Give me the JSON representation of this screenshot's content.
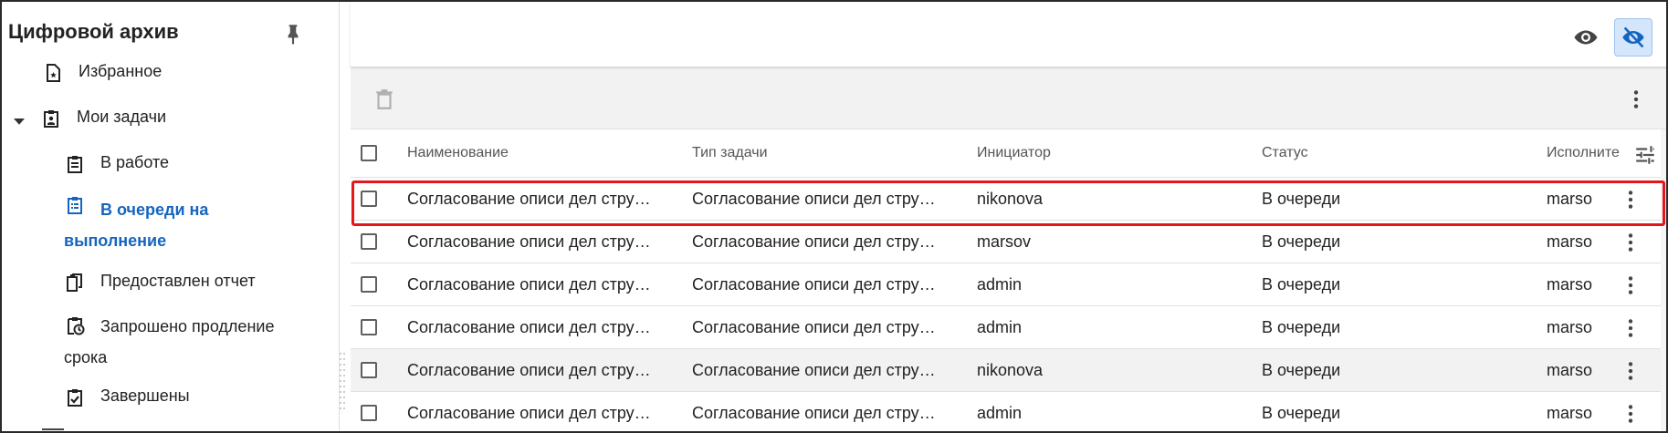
{
  "sidebar": {
    "title": "Цифровой архив",
    "items": [
      {
        "label": "Избранное",
        "icon": "favorite-doc-icon"
      },
      {
        "label": "Мои задачи",
        "icon": "clipboard-user-icon"
      },
      {
        "label": "В работе",
        "icon": "clipboard-list-icon"
      },
      {
        "label": "В очереди на выполнение",
        "icon": "clipboard-queue-icon"
      },
      {
        "label": "Предоставлен отчет",
        "icon": "report-copy-icon"
      },
      {
        "label": "Запрошено продление срока",
        "icon": "clipboard-clock-icon"
      },
      {
        "label": "Завершены",
        "icon": "clipboard-check-icon"
      }
    ],
    "active_color": "#1565c0"
  },
  "table": {
    "columns": [
      "Наименование",
      "Тип задачи",
      "Инициатор",
      "Статус",
      "Исполните"
    ],
    "rows": [
      {
        "name": "Согласование описи дел стру…",
        "type": "Согласование описи дел стру…",
        "initiator": "nikonova",
        "status": "В очереди",
        "executor": "marsov"
      },
      {
        "name": "Согласование описи дел стру…",
        "type": "Согласование описи дел стру…",
        "initiator": "marsov",
        "status": "В очереди",
        "executor": "marsov"
      },
      {
        "name": "Согласование описи дел стру…",
        "type": "Согласование описи дел стру…",
        "initiator": "admin",
        "status": "В очереди",
        "executor": "marsov"
      },
      {
        "name": "Согласование описи дел стру…",
        "type": "Согласование описи дел стру…",
        "initiator": "admin",
        "status": "В очереди",
        "executor": "marsov"
      },
      {
        "name": "Согласование описи дел стру…",
        "type": "Согласование описи дел стру…",
        "initiator": "nikonova",
        "status": "В очереди",
        "executor": "marsov"
      },
      {
        "name": "Согласование описи дел стру…",
        "type": "Согласование описи дел стру…",
        "initiator": "admin",
        "status": "В очереди",
        "executor": "marsov"
      }
    ],
    "highlight_color": "#e4151b"
  },
  "toolbar": {
    "eye_icon": "eye-icon",
    "eye_off_icon": "eye-off-icon",
    "delete_icon": "trash-icon"
  }
}
